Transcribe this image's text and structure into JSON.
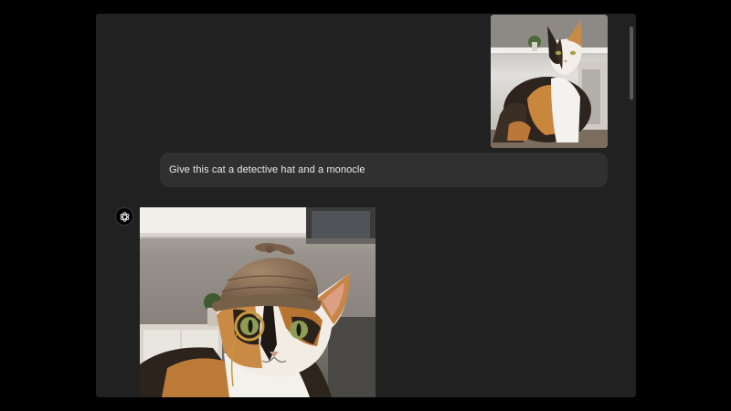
{
  "conversation": {
    "user_message": {
      "image_alt": "calico cat sitting in a kitchen",
      "text": "Give this cat a detective hat and a monocle"
    },
    "assistant_message": {
      "avatar_icon": "openai-logo-icon",
      "image_alt": "calico cat wearing a deerstalker detective hat and a gold monocle"
    }
  },
  "colors": {
    "page_background": "#000000",
    "chat_background": "#212121",
    "user_bubble": "#303030",
    "text": "#ececec"
  }
}
